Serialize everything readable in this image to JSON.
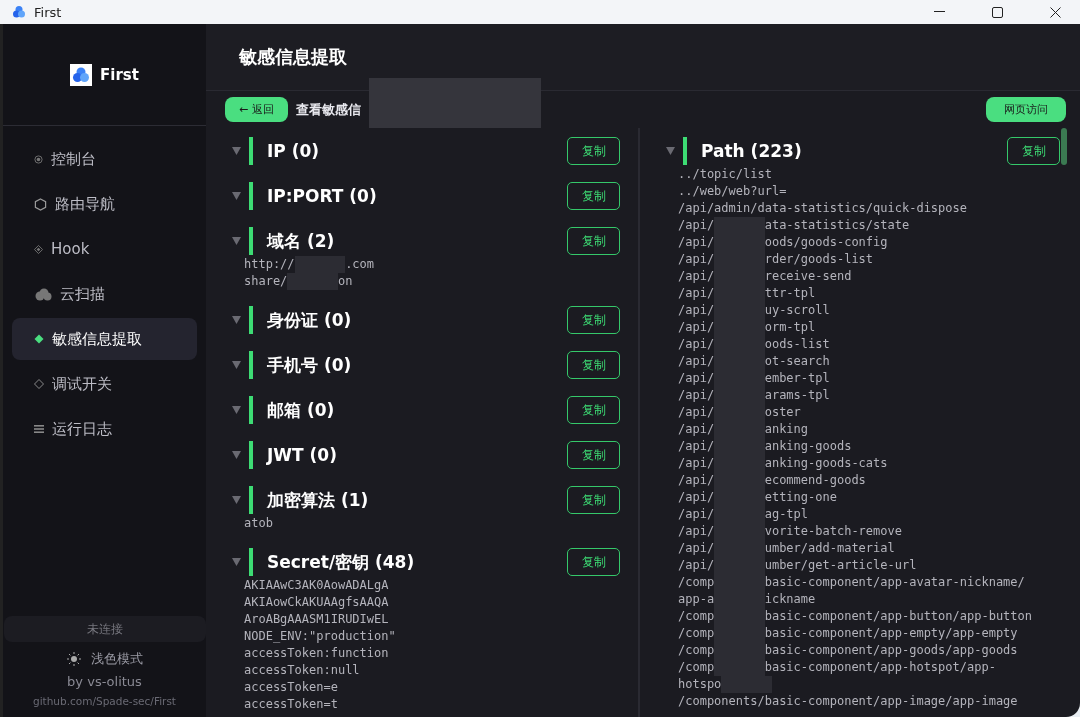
{
  "window": {
    "title": "First"
  },
  "sidebar": {
    "brand": "First",
    "items": [
      {
        "label": "控制台",
        "selected": false
      },
      {
        "label": "路由导航",
        "selected": false
      },
      {
        "label": "Hook",
        "selected": false
      },
      {
        "label": "云扫描",
        "selected": false
      },
      {
        "label": "敏感信息提取",
        "selected": true
      },
      {
        "label": "调试开关",
        "selected": false
      },
      {
        "label": "运行日志",
        "selected": false
      }
    ],
    "status": "未连接",
    "theme_toggle": "浅色模式",
    "author": "by vs-olitus",
    "repo": "github.com/Spade-sec/First"
  },
  "page_title": "敏感信息提取",
  "toolbar": {
    "back_button": "← 返回",
    "caption": "查看敏感信",
    "caption_redacted": true,
    "visit_button": "网页访问"
  },
  "left_sections": [
    {
      "title": "IP (0)",
      "copy_button": "复制"
    },
    {
      "title": "IP:PORT (0)",
      "copy_button": "复制"
    },
    {
      "title": "域名 (2)",
      "copy_button": "复制",
      "lines": [
        {
          "text": "http://",
          "redacted": true,
          "tail": ".com"
        },
        {
          "text": "share/",
          "redacted": true,
          "tail": "on"
        }
      ]
    },
    {
      "title": "身份证 (0)",
      "copy_button": "复制"
    },
    {
      "title": "手机号 (0)",
      "copy_button": "复制"
    },
    {
      "title": "邮箱 (0)",
      "copy_button": "复制"
    },
    {
      "title": "JWT (0)",
      "copy_button": "复制"
    },
    {
      "title": "加密算法 (1)",
      "copy_button": "复制",
      "lines": [
        {
          "text": "atob",
          "redacted": false
        }
      ]
    },
    {
      "title": "Secret/密钥 (48)",
      "copy_button": "复制",
      "lines": [
        {
          "text": "AKIAAwC3AK0AowADALgA",
          "redacted": false
        },
        {
          "text": "AKIAowCkAKUAAgfsAAQA",
          "redacted": false
        },
        {
          "text": "AroABgAAASM1IRUDIwEL",
          "redacted": false
        },
        {
          "text": "NODE_ENV:\"production\"",
          "redacted": false
        },
        {
          "text": "accessToken:function",
          "redacted": false
        },
        {
          "text": "accessToken:null",
          "redacted": false
        },
        {
          "text": "accessToken=e",
          "redacted": false
        },
        {
          "text": "accessToken=t",
          "redacted": false
        }
      ]
    }
  ],
  "right_sections": [
    {
      "title": "Path (223)",
      "copy_button": "复制",
      "lines": [
        {
          "text": "../topic/list",
          "redacted": false
        },
        {
          "text": "../web/web?url=",
          "redacted": false
        },
        {
          "text": "/api/admin/data-statistics/quick-dispose",
          "redacted": false
        },
        {
          "text": "/api/",
          "redacted": true,
          "tail": "ata-statistics/state"
        },
        {
          "text": "/api/",
          "redacted": true,
          "tail": "oods/goods-config"
        },
        {
          "text": "/api/",
          "redacted": true,
          "tail": "rder/goods-list"
        },
        {
          "text": "/api/",
          "redacted": true,
          "tail": "receive-send"
        },
        {
          "text": "/api/",
          "redacted": true,
          "tail": "ttr-tpl"
        },
        {
          "text": "/api/",
          "redacted": true,
          "tail": "uy-scroll"
        },
        {
          "text": "/api/",
          "redacted": true,
          "tail": "orm-tpl"
        },
        {
          "text": "/api/",
          "redacted": true,
          "tail": "oods-list"
        },
        {
          "text": "/api/",
          "redacted": true,
          "tail": "ot-search"
        },
        {
          "text": "/api/",
          "redacted": true,
          "tail": "ember-tpl"
        },
        {
          "text": "/api/",
          "redacted": true,
          "tail": "arams-tpl"
        },
        {
          "text": "/api/",
          "redacted": true,
          "tail": "oster"
        },
        {
          "text": "/api/",
          "redacted": true,
          "tail": "anking"
        },
        {
          "text": "/api/",
          "redacted": true,
          "tail": "anking-goods"
        },
        {
          "text": "/api/",
          "redacted": true,
          "tail": "anking-goods-cats"
        },
        {
          "text": "/api/",
          "redacted": true,
          "tail": "ecommend-goods"
        },
        {
          "text": "/api/",
          "redacted": true,
          "tail": "etting-one"
        },
        {
          "text": "/api/",
          "redacted": true,
          "tail": "ag-tpl"
        },
        {
          "text": "/api/",
          "redacted": true,
          "tail": "vorite-batch-remove"
        },
        {
          "text": "/api/",
          "redacted": true,
          "tail": "umber/add-material"
        },
        {
          "text": "/api/",
          "redacted": true,
          "tail": "umber/get-article-url"
        },
        {
          "text": "/comp",
          "redacted": true,
          "tail": "basic-component/app-avatar-nickname/"
        },
        {
          "text": "app-a",
          "redacted": true,
          "tail": "ickname"
        },
        {
          "text": "/comp",
          "redacted": true,
          "tail": "basic-component/app-button/app-button"
        },
        {
          "text": "/comp",
          "redacted": true,
          "tail": "basic-component/app-empty/app-empty"
        },
        {
          "text": "/comp",
          "redacted": true,
          "tail": "basic-component/app-goods/app-goods"
        },
        {
          "text": "/comp",
          "redacted": true,
          "tail": "basic-component/app-hotspot/app-"
        },
        {
          "text": "hotspo",
          "redacted": true
        },
        {
          "text": "/components/basic-component/app-image/app-image",
          "redacted": false
        }
      ]
    }
  ]
}
